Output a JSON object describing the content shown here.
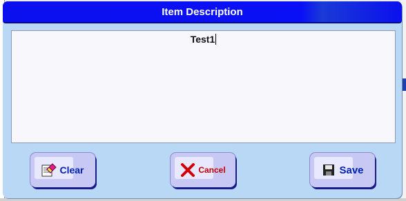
{
  "dialog": {
    "title": "Item Description",
    "text_value": "Test1"
  },
  "buttons": {
    "clear": {
      "label": "Clear",
      "icon": "eraser-icon"
    },
    "cancel": {
      "label": "Cancel",
      "icon": "x-mark-icon",
      "color": "#c00000"
    },
    "save": {
      "label": "Save",
      "icon": "floppy-disk-icon"
    }
  },
  "colors": {
    "titlebar": "#0a10ee",
    "dialog_bg": "#b9d8f5",
    "button_face": "#c8c8f4",
    "button_text": "#0020b0"
  }
}
